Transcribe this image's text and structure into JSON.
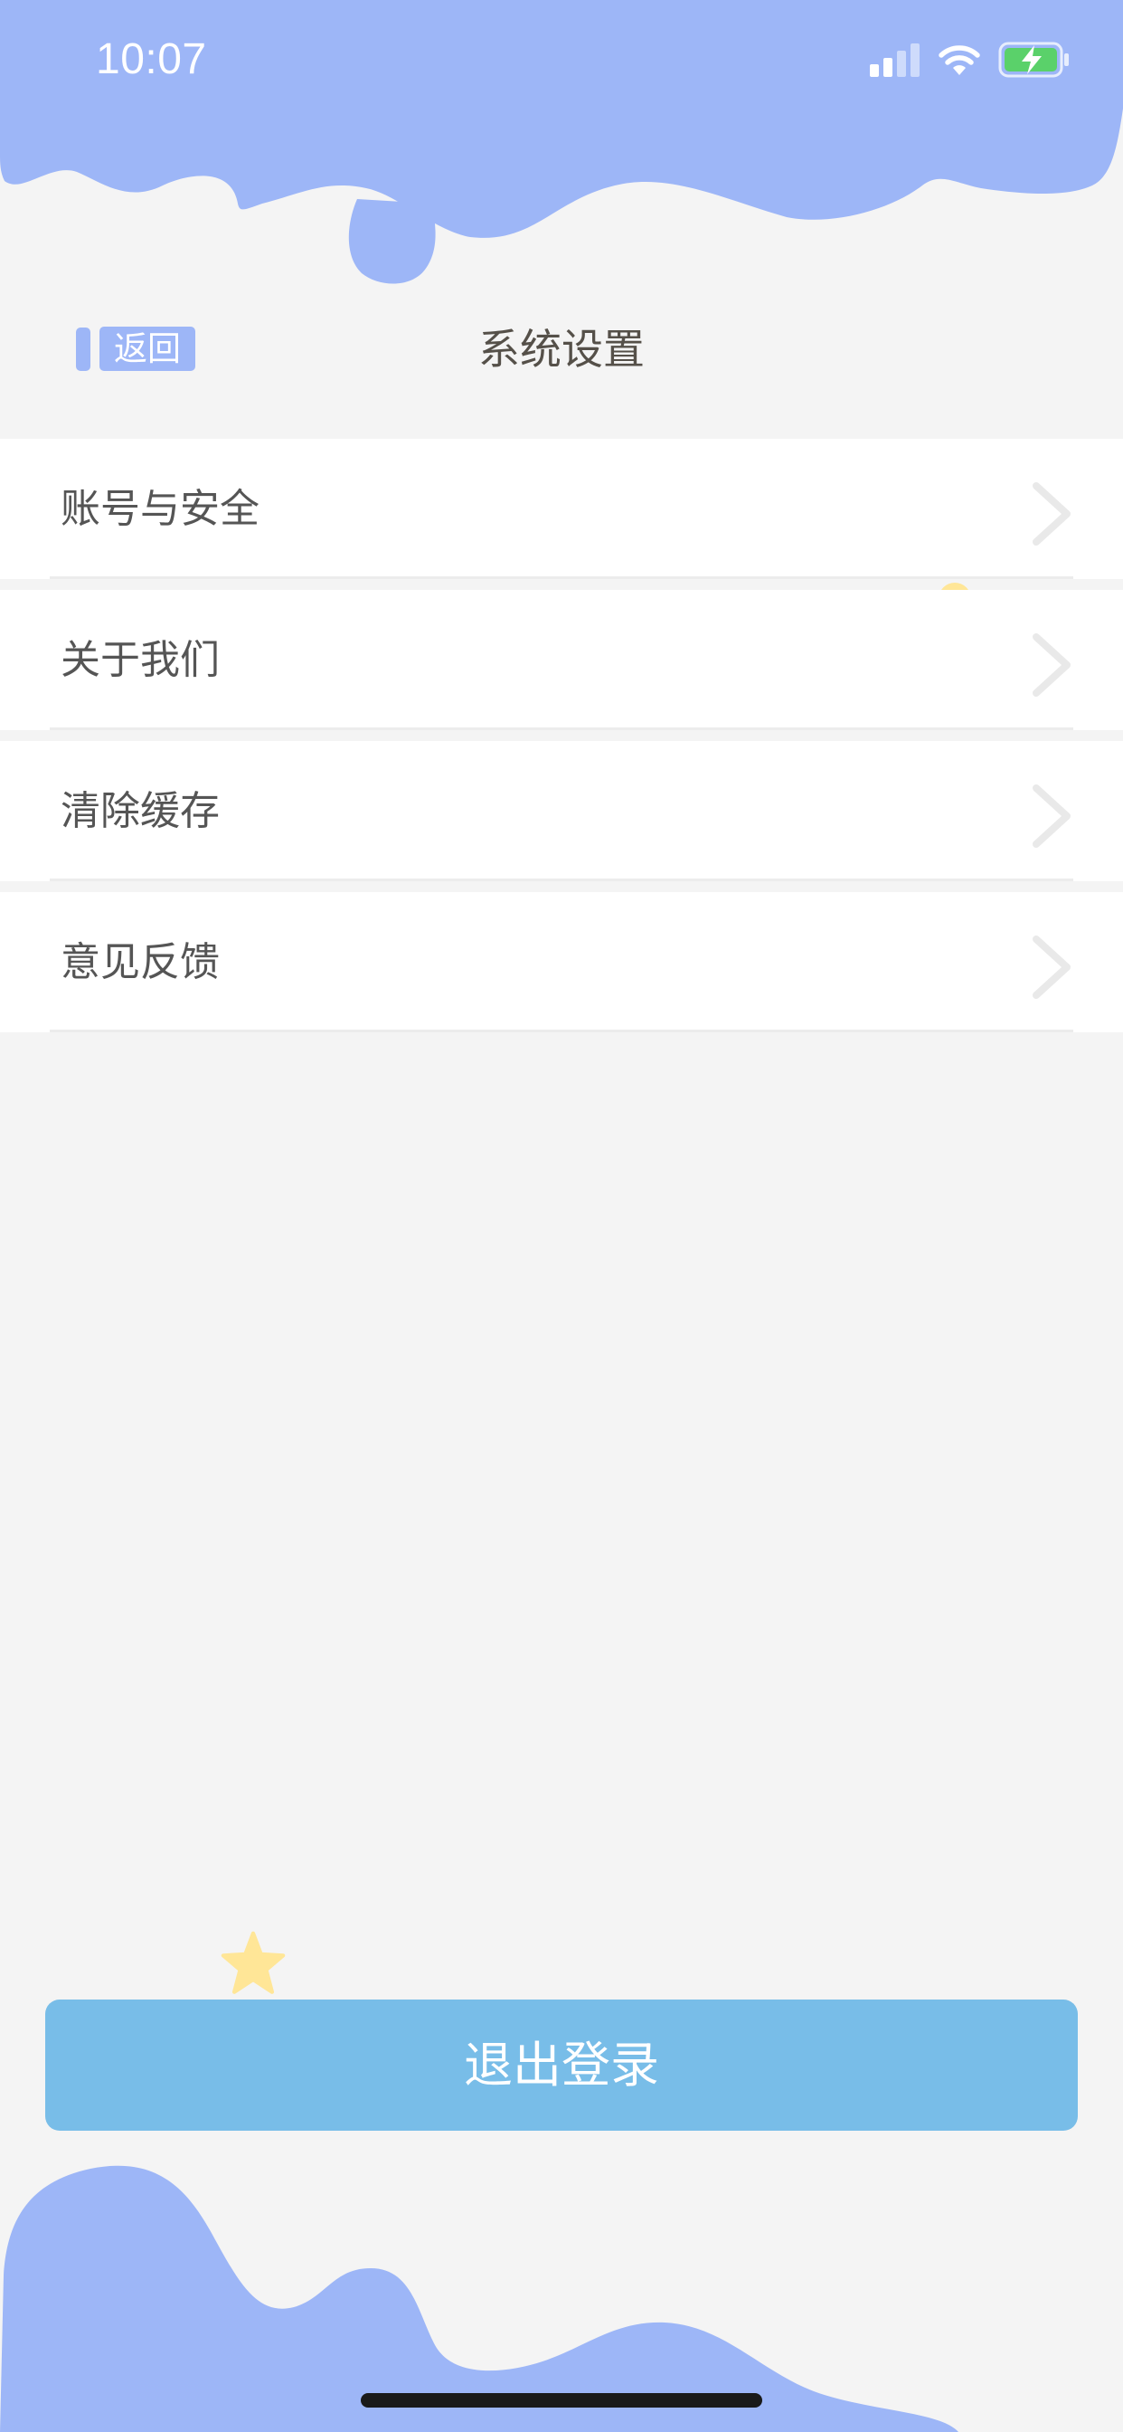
{
  "status_bar": {
    "time": "10:07",
    "battery_state": "charging"
  },
  "nav": {
    "back_label": "返回",
    "title": "系统设置"
  },
  "menu": {
    "items": [
      {
        "label": "账号与安全"
      },
      {
        "label": "关于我们"
      },
      {
        "label": "清除缓存"
      },
      {
        "label": "意见反馈"
      }
    ]
  },
  "logout": {
    "label": "退出登录"
  },
  "colors": {
    "accent_blob": "#9db6f7",
    "logout_button": "#78bde8",
    "star": "#ffe697",
    "background": "#f4f4f4"
  },
  "icons": [
    "signal-icon",
    "wifi-icon",
    "battery-charging-icon",
    "chevron-right-icon",
    "star-icon"
  ]
}
